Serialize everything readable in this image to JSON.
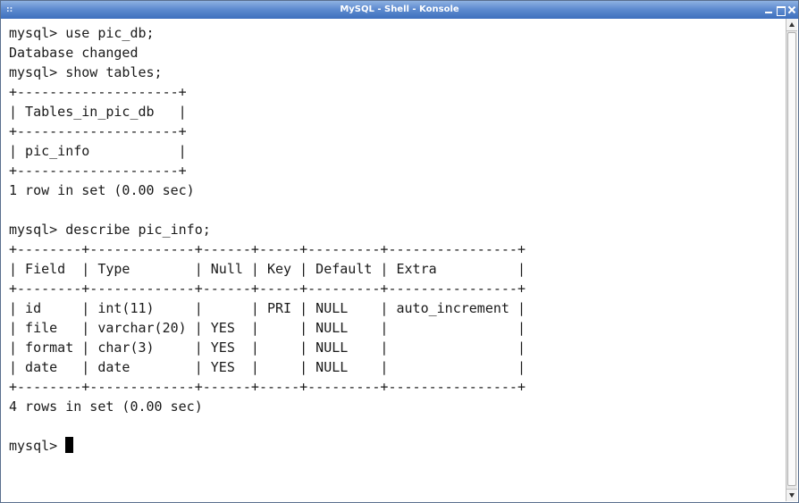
{
  "window": {
    "title": "MySQL - Shell - Konsole",
    "system_menu_glyph": "::"
  },
  "terminal": {
    "lines": [
      "mysql> use pic_db;",
      "Database changed",
      "mysql> show tables;",
      "+--------------------+",
      "| Tables_in_pic_db   |",
      "+--------------------+",
      "| pic_info           |",
      "+--------------------+",
      "1 row in set (0.00 sec)",
      "",
      "mysql> describe pic_info;",
      "+--------+-------------+------+-----+---------+----------------+",
      "| Field  | Type        | Null | Key | Default | Extra          |",
      "+--------+-------------+------+-----+---------+----------------+",
      "| id     | int(11)     |      | PRI | NULL    | auto_increment |",
      "| file   | varchar(20) | YES  |     | NULL    |                |",
      "| format | char(3)     | YES  |     | NULL    |                |",
      "| date   | date        | YES  |     | NULL    |                |",
      "+--------+-------------+------+-----+---------+----------------+",
      "4 rows in set (0.00 sec)",
      ""
    ],
    "prompt": "mysql> "
  },
  "colors": {
    "titlebar": "#4f7fc8",
    "text": "#1a1a1a",
    "background": "#ffffff"
  }
}
